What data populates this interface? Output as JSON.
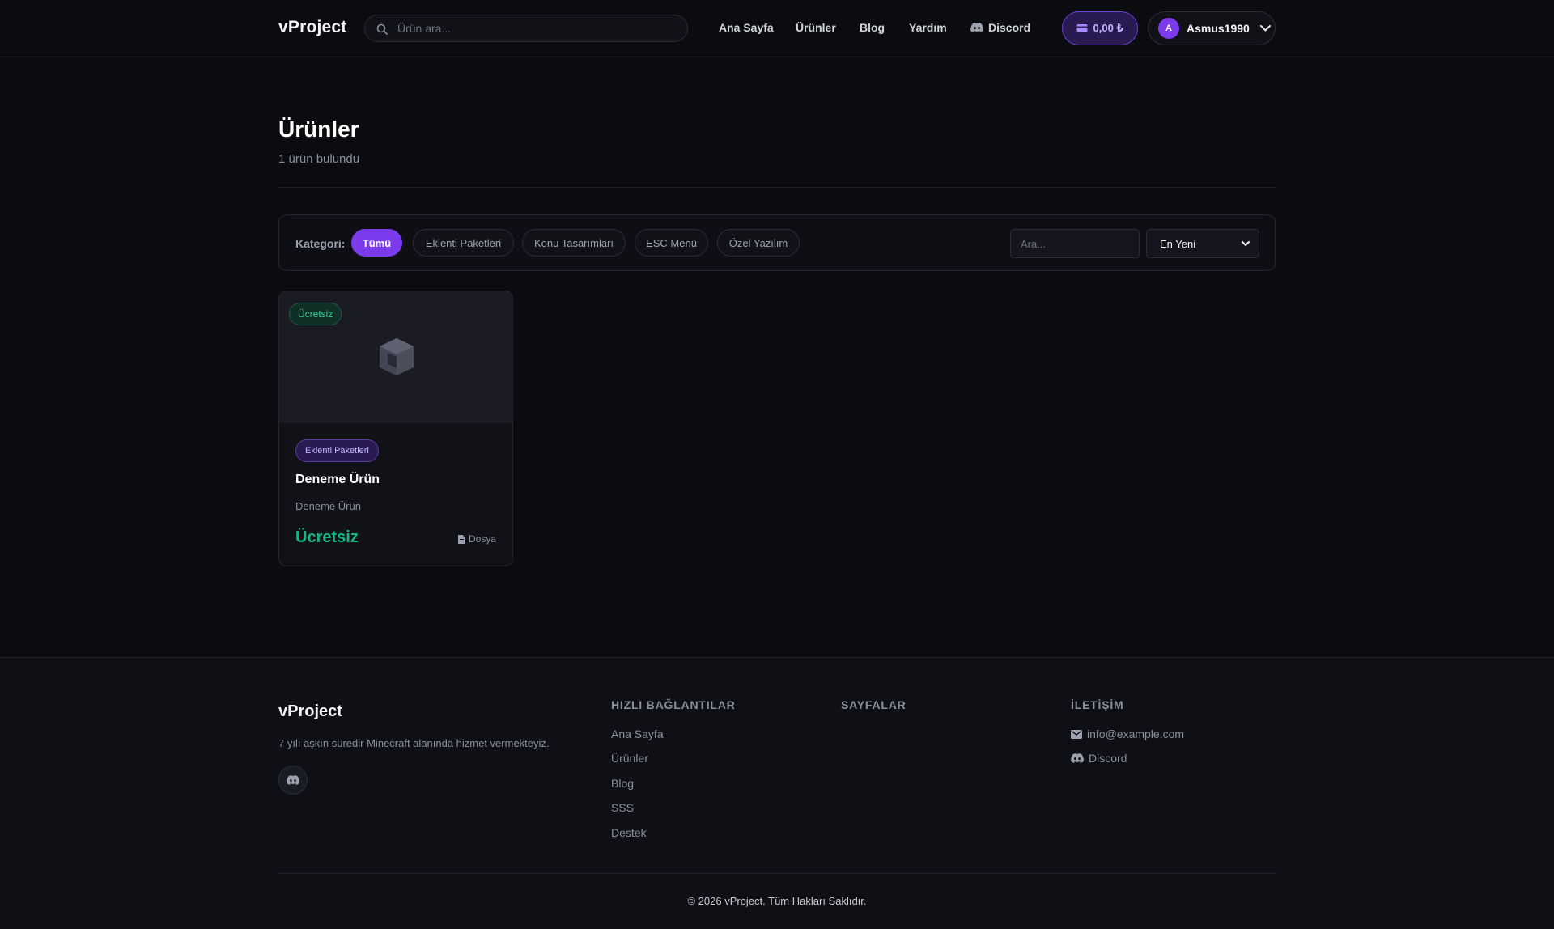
{
  "nav": {
    "brand": "vProject",
    "search_placeholder": "Ürün ara...",
    "links": [
      "Ana Sayfa",
      "Ürünler",
      "Blog",
      "Yardım",
      "Discord"
    ],
    "cart_amount": "0,00 ₺",
    "user_initial": "A",
    "username": "Asmus1990"
  },
  "header": {
    "title": "Ürünler",
    "subtitle": "1 ürün bulundu"
  },
  "filters": {
    "label": "Kategori:",
    "categories": [
      "Tümü",
      "Eklenti Paketleri",
      "Konu Tasarımları",
      "ESC Menü",
      "Özel Yazılım"
    ],
    "active_category": "Tümü",
    "search_placeholder": "Ara...",
    "sort_selected": "En Yeni"
  },
  "products": [
    {
      "badge": "Ücretsiz",
      "category": "Eklenti Paketleri",
      "title": "Deneme Ürün",
      "description": "Deneme Ürün",
      "price": "Ücretsiz",
      "type": "Dosya",
      "icon": "cube-icon"
    }
  ],
  "footer": {
    "brand": "vProject",
    "description": "7 yılı aşkın süredir Minecraft alanında hizmet vermekteyiz.",
    "quick_links_title": "HIZLI BAĞLANTILAR",
    "quick_links": [
      "Ana Sayfa",
      "Ürünler",
      "Blog",
      "SSS",
      "Destek"
    ],
    "pages_title": "SAYFALAR",
    "contact_title": "İLETİŞİM",
    "email": "info@example.com",
    "discord": "Discord",
    "copyright": "© 2026 vProject. Tüm Hakları Saklıdır."
  },
  "colors": {
    "accent": "#7c3aed",
    "free_green": "#10b981",
    "background": "#0b0c10"
  }
}
